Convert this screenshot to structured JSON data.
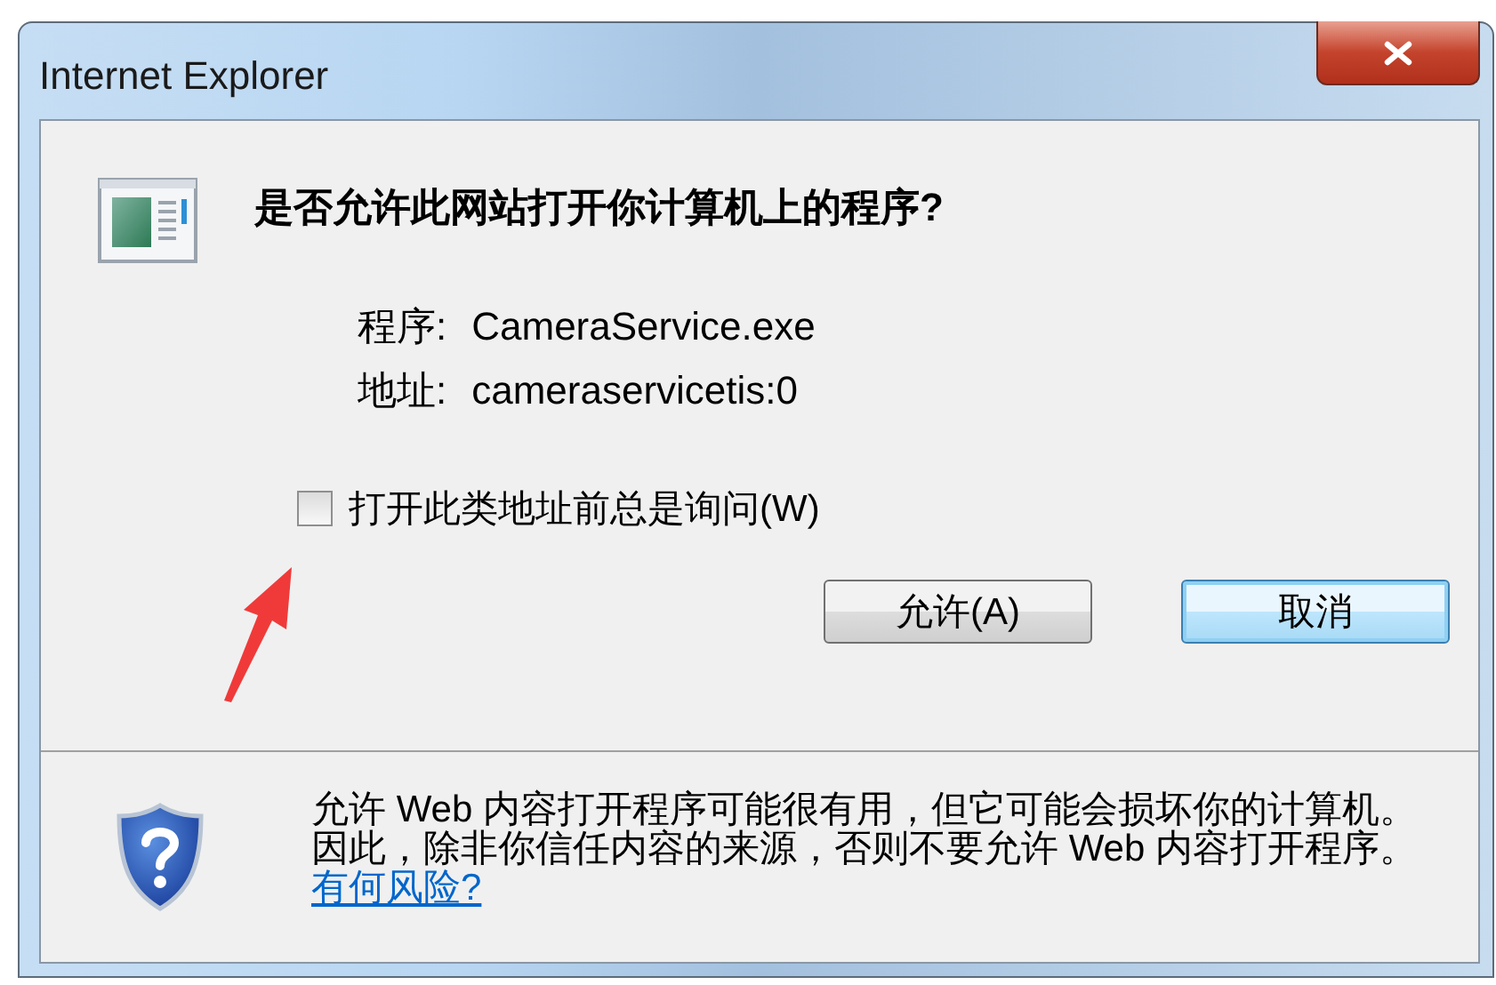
{
  "window": {
    "title": "Internet Explorer"
  },
  "question": "是否允许此网站打开你计算机上的程序?",
  "details": [
    {
      "label": "程序:",
      "value": "CameraService.exe"
    },
    {
      "label": "地址:",
      "value": "cameraservicetis:0"
    }
  ],
  "checkbox": {
    "label": "打开此类地址前总是询问(W)",
    "checked": false
  },
  "buttons": [
    {
      "label": "允许(A)",
      "default": false
    },
    {
      "label": "取消",
      "default": true
    }
  ],
  "warning": {
    "text": "允许 Web 内容打开程序可能很有用，但它可能会损坏你的计算机。因此，除非你信任内容的来源，否则不要允许 Web 内容打开程序。",
    "link": "有何风险?"
  }
}
